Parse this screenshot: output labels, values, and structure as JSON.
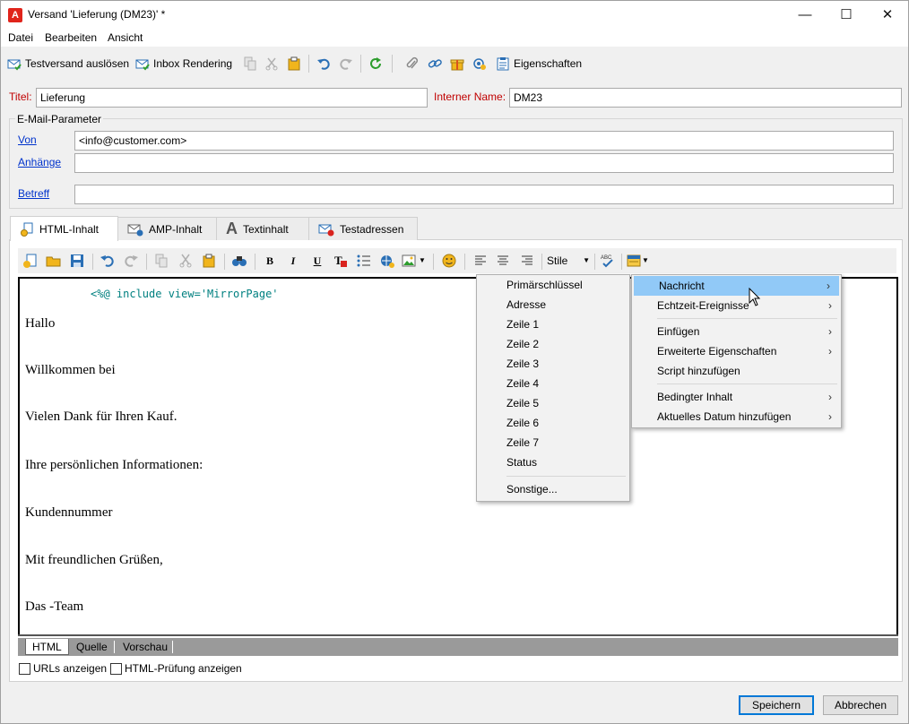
{
  "window": {
    "title": "Versand 'Lieferung (DM23)' *",
    "app_icon": "A",
    "controls": [
      "—",
      "☐",
      "✕"
    ]
  },
  "menubar": [
    "Datei",
    "Bearbeiten",
    "Ansicht"
  ],
  "toolbar": {
    "testversand": "Testversand auslösen",
    "inbox_rendering": "Inbox Rendering",
    "eigenschaften": "Eigenschaften"
  },
  "form": {
    "titel_label": "Titel:",
    "titel_value": "Lieferung",
    "interner_name_label": "Interner Name:",
    "interner_name_value": "DM23"
  },
  "email_params": {
    "group_title": "E-Mail-Parameter",
    "von_label": "Von",
    "von_value": "<info@customer.com>",
    "anhaenge_label": "Anhänge",
    "anhaenge_value": "",
    "betreff_label": "Betreff",
    "betreff_value": ""
  },
  "tabs": [
    "HTML-Inhalt",
    "AMP-Inhalt",
    "Textinhalt",
    "Testadressen"
  ],
  "editor_toolbar": {
    "stile": "Stile"
  },
  "editor": {
    "code_line": "<%@ include view='MirrorPage'",
    "lines": [
      "Hallo",
      "Willkommen bei",
      "Vielen Dank für Ihren Kauf.",
      "Ihre persönlichen Informationen:",
      "Kundennummer",
      "Mit freundlichen Grüßen,",
      "Das -Team"
    ]
  },
  "bottom_tabs": [
    "HTML",
    "Quelle",
    "Vorschau"
  ],
  "checkboxes": {
    "urls": "URLs anzeigen",
    "html_check": "HTML-Prüfung anzeigen"
  },
  "buttons": {
    "save": "Speichern",
    "cancel": "Abbrechen"
  },
  "context_menu": {
    "items": [
      "Nachricht",
      "Echtzeit-Ereignisse",
      "Einfügen",
      "Erweiterte Eigenschaften",
      "Script hinzufügen",
      "Bedingter Inhalt",
      "Aktuelles Datum hinzufügen"
    ],
    "highlight_color": "#91c9f7"
  },
  "submenu": {
    "items": [
      "Primärschlüssel",
      "Adresse",
      "Zeile 1",
      "Zeile 2",
      "Zeile 3",
      "Zeile 4",
      "Zeile 5",
      "Zeile 6",
      "Zeile 7",
      "Status",
      "Sonstige..."
    ]
  }
}
